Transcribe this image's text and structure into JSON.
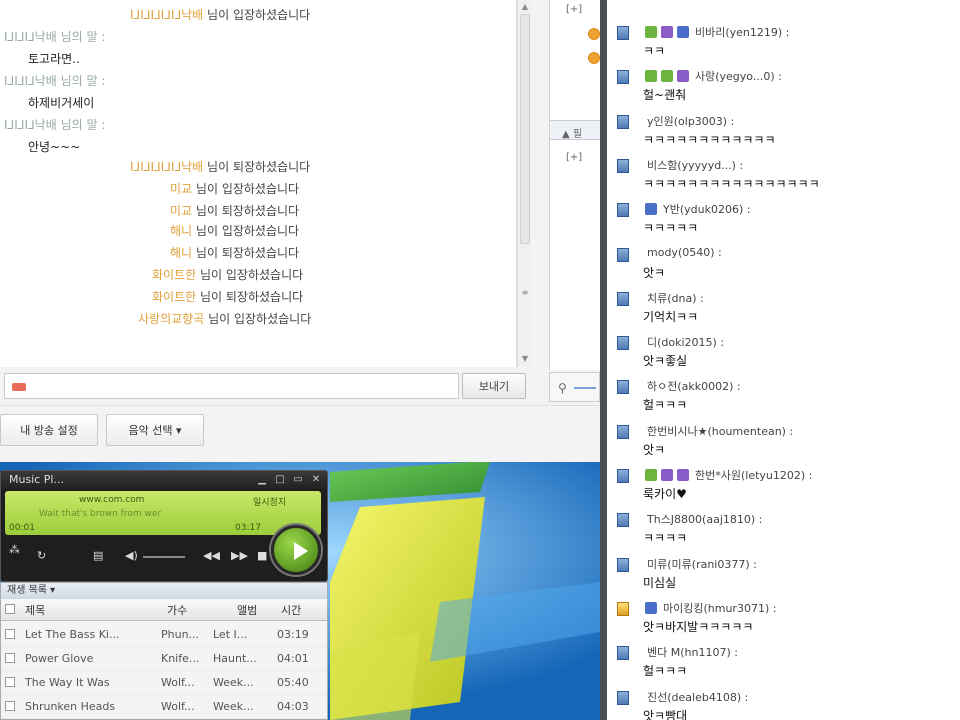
{
  "chat": {
    "lines": [
      {
        "kind": "sys",
        "nick": "Ⅰ⅃Ⅰ⅃Ⅰ⅃Ⅰ⅃Ⅰ⅃낙배",
        "msg": "님이 입장하셨습니다"
      },
      {
        "kind": "hdr",
        "text": "Ⅰ⅃Ⅰ⅃Ⅰ⅃낙배 님의 말 :"
      },
      {
        "kind": "body",
        "text": "토고라면.."
      },
      {
        "kind": "hdr",
        "text": "Ⅰ⅃Ⅰ⅃Ⅰ⅃낙배 님의 말 :"
      },
      {
        "kind": "body",
        "text": "하제비거세이"
      },
      {
        "kind": "hdr",
        "text": "Ⅰ⅃Ⅰ⅃Ⅰ⅃낙배 님의 말 :"
      },
      {
        "kind": "body",
        "text": "안녕~~~"
      },
      {
        "kind": "sys",
        "nick": "Ⅰ⅃Ⅰ⅃Ⅰ⅃Ⅰ⅃Ⅰ⅃낙배",
        "msg": "님이 퇴장하셨습니다"
      },
      {
        "kind": "sys",
        "nick": "미교",
        "msg": "님이 입장하셨습니다"
      },
      {
        "kind": "sys",
        "nick": "미교",
        "msg": "님이 퇴장하셨습니다"
      },
      {
        "kind": "sys",
        "nick": "해니",
        "msg": "님이 입장하셨습니다"
      },
      {
        "kind": "sys",
        "nick": "해니",
        "msg": "님이 퇴장하셨습니다"
      },
      {
        "kind": "sys",
        "nick": "화이트한",
        "msg": "님이 입장하셨습니다"
      },
      {
        "kind": "sys",
        "nick": "화이트한",
        "msg": "님이 퇴장하셨습니다"
      },
      {
        "kind": "sys",
        "nick": "사랑의교향곡",
        "msg": "님이 입장하셨습니다"
      }
    ],
    "input_value": "",
    "send_label": "보내기"
  },
  "tree": {
    "node_a": "[+]",
    "node_b": "▲ 필",
    "node_c": "[+]"
  },
  "toolbar": {
    "broadcast_label": "내 방송 설정",
    "music_label": "음악 선택 ▾"
  },
  "player": {
    "title": "Music Pl...",
    "site": "www.com.com",
    "status": "일시정지",
    "track_text": "Wait that's brown from wer",
    "time_elapsed": "00:01",
    "time_total": "03:17"
  },
  "playlist": {
    "title": "재생 목록 ▾",
    "columns": [
      "제목",
      "가수",
      "앨범",
      "시간"
    ],
    "rows": [
      [
        "Let The Bass Ki...",
        "Phun...",
        "Let I...",
        "03:19"
      ],
      [
        "Power Glove",
        "Knife...",
        "Haunt...",
        "04:01"
      ],
      [
        "The Way It Was",
        "Wolf...",
        "Week...",
        "05:40"
      ],
      [
        "Shrunken Heads",
        "Wolf...",
        "Week...",
        "04:03"
      ]
    ]
  },
  "members": [
    {
      "name": "비바리(yen1219) :",
      "msg": "ㅋㅋ",
      "badges": [
        "#6db33f",
        "#8a5cc8",
        "#4a6fc8"
      ],
      "icon": "pc"
    },
    {
      "name": "사랑(yegyo...0) :",
      "msg": "헐~괜춰",
      "badges": [
        "#6db33f",
        "#6db33f",
        "#8a5cc8"
      ],
      "icon": "pc"
    },
    {
      "name": "y인원(olp3003) :",
      "msg": "ㅋㅋㅋㅋㅋㅋㅋㅋㅋㅋㅋㅋ",
      "badges": [],
      "icon": "pc"
    },
    {
      "name": "비스함(yyyyyd...) :",
      "msg": "ㅋㅋㅋㅋㅋㅋㅋㅋㅋㅋㅋㅋㅋㅋㅋㅋ",
      "badges": [],
      "icon": "pc"
    },
    {
      "name": "Y반(yduk0206) :",
      "msg": "ㅋㅋㅋㅋㅋ",
      "badges": [
        "#4a6fc8"
      ],
      "icon": "pc"
    },
    {
      "name": "mody(0540) :",
      "msg": "앗ㅋ",
      "badges": [],
      "icon": "pc"
    },
    {
      "name": "치류(dna) :",
      "msg": "기억치ㅋㅋ",
      "badges": [],
      "icon": "pc"
    },
    {
      "name": "디(doki2015) :",
      "msg": "앗ㅋ좋실",
      "badges": [],
      "icon": "pc"
    },
    {
      "name": "하ㅇ전(akk0002) :",
      "msg": "헐ㅋㅋㅋ",
      "badges": [],
      "icon": "pc"
    },
    {
      "name": "한번비시나★(houmentean) :",
      "msg": "앗ㅋ",
      "badges": [],
      "icon": "pc"
    },
    {
      "name": "한번*사원(letyu1202) :",
      "msg": "룩카이♥",
      "badges": [
        "#6db33f",
        "#8a5cc8",
        "#8a5cc8"
      ],
      "icon": "pc"
    },
    {
      "name": "Th스J8800(aaj1810) :",
      "msg": "ㅋㅋㅋㅋ",
      "badges": [],
      "icon": "pc"
    },
    {
      "name": "미류(미류(rani0377) :",
      "msg": "미심실",
      "badges": [],
      "icon": "pc"
    },
    {
      "name": "마이킹킹(hmur3071) :",
      "msg": "앗ㅋ바지발ㅋㅋㅋㅋㅋ",
      "badges": [
        "#4a6fc8"
      ],
      "icon": "crown"
    },
    {
      "name": "벤다 M(hn1107) :",
      "msg": "헐ㅋㅋㅋ",
      "badges": [],
      "icon": "pc"
    },
    {
      "name": "진선(dealeb4108) :",
      "msg": "앗ㅋ빵대",
      "badges": [],
      "icon": "pc"
    }
  ]
}
